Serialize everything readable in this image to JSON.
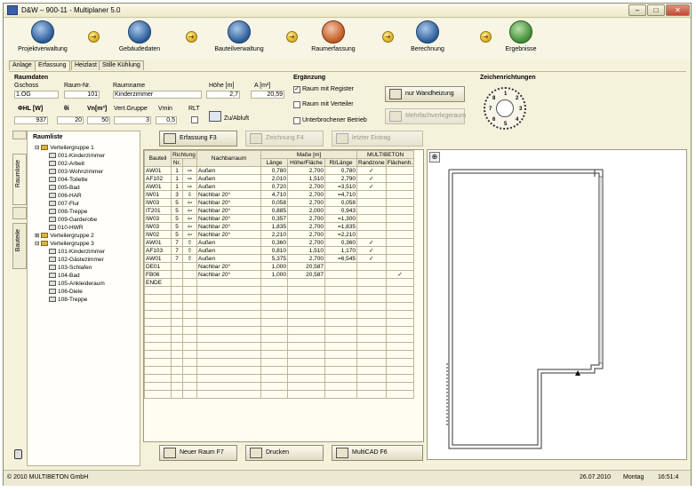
{
  "title": "D&W – 900-11 - Multiplaner 5.0",
  "window_controls": {
    "min": "–",
    "max": "□",
    "close": "✕"
  },
  "toolbar": [
    {
      "label": "Projektverwaltung",
      "icon": "project-icon"
    },
    {
      "label": "Gebäudedaten",
      "icon": "building-icon"
    },
    {
      "label": "Bauteilverwaltung",
      "icon": "component-icon"
    },
    {
      "label": "Raumerfassung",
      "icon": "room-entry-icon"
    },
    {
      "label": "Berechnung",
      "icon": "calculation-icon"
    },
    {
      "label": "Ergebnisse",
      "icon": "results-icon"
    }
  ],
  "tabs": [
    "Anlage",
    "Erfassung",
    "Heizlast",
    "Stille Kühlung"
  ],
  "raumdaten": {
    "heading": "Raumdaten",
    "geschoss_label": "Gschoss",
    "geschoss": "1.OG",
    "raumnr_label": "Raum-Nr.",
    "raumnr": "101",
    "raumname_label": "Raumname",
    "raumname": "Kinderzimmer",
    "hoehe_label": "Höhe [m]",
    "hoehe": "2,7",
    "flaeche_label": "A [m²]",
    "flaeche": "20,59",
    "phi_label": "ΦHL [W]",
    "phi": "937",
    "theta_label": "θi",
    "theta": "20",
    "vn_label": "Vn[m³]",
    "vn": "50",
    "vert_label": "Vert.Gruppe",
    "vert": "3",
    "vmin_label": "Vmin",
    "vmin": "0,5",
    "rlt_label": "RLT",
    "zu_abluft": "Zu/Abluft"
  },
  "ergaenzung": {
    "heading": "Ergänzung",
    "options": [
      {
        "label": "Raum mit Register",
        "checked": true
      },
      {
        "label": "Raum mit Verteiler",
        "checked": false
      },
      {
        "label": "Unterbrochener Betrieb",
        "checked": false
      }
    ]
  },
  "buttons": {
    "wandheizung": "nur Wandheizung",
    "mehrfach": "Mehrfachverlegeraum",
    "erfassung": "Erfassung F3",
    "zeichnung": "Zeichnung F4",
    "letzter": "letzter Eintrag",
    "neuer_raum": "Neuer Raum F7",
    "drucken": "Drucken",
    "multicad": "MultiCAD F6"
  },
  "zeichen": {
    "heading": "Zeichenrichtungen",
    "numbers": [
      "1",
      "2",
      "3",
      "4",
      "5",
      "6",
      "7",
      "8"
    ]
  },
  "sidebar_tabs": [
    "Raumliste",
    "Bauteile"
  ],
  "tree": {
    "heading": "Raumliste",
    "groups": [
      {
        "label": "Verteilergruppe 1",
        "rooms": [
          "001-Kinderzimmer",
          "002-Arbeit",
          "003-Wohnzimmer",
          "004-Toilette",
          "005-Bad",
          "006-HAR",
          "007-Flur",
          "008-Treppe",
          "009-Garderobe",
          "010-HWR"
        ]
      },
      {
        "label": "Verteilergruppe 2",
        "rooms": []
      },
      {
        "label": "Verteilergruppe 3",
        "rooms": [
          "101-Kinderzimmer",
          "102-Gästezimmer",
          "103-Schlafen",
          "104-Bad",
          "105-Ankleideraum",
          "106-Diele",
          "108-Treppe"
        ]
      }
    ]
  },
  "grid": {
    "headers": {
      "bauteil": "Bauteil",
      "richtung": "Richtung",
      "nr": "Nr.",
      "nachbarraum": "Nachbarraum",
      "masse": "Maße [m]",
      "laenge": "Länge",
      "hoehe": "Höhe/Fläche",
      "rl": "Rl/Länge",
      "multibeton": "MULTIBETON",
      "randzone": "Randzone",
      "flaechenh": "Flächenh."
    },
    "rows": [
      {
        "bt": "AW01",
        "nr": "1",
        "dir": "⇨",
        "nb": "Außen",
        "l": "0,780",
        "h": "2,700",
        "rl": "0,780",
        "rz": "✓",
        "fh": ""
      },
      {
        "bt": "AF102",
        "nr": "1",
        "dir": "⇨",
        "nb": "Außen",
        "l": "2,010",
        "h": "1,510",
        "rl": "2,790",
        "rz": "✓",
        "fh": ""
      },
      {
        "bt": "AW01",
        "nr": "1",
        "dir": "⇨",
        "nb": "Außen",
        "l": "0,720",
        "h": "2,700",
        "rl": "=3,510",
        "rz": "✓",
        "fh": ""
      },
      {
        "bt": "IW01",
        "nr": "3",
        "dir": "⇩",
        "nb": "Nachbar 20°",
        "l": "4,710",
        "h": "2,700",
        "rl": "=4,710",
        "rz": "",
        "fh": ""
      },
      {
        "bt": "IW03",
        "nr": "5",
        "dir": "⇦",
        "nb": "Nachbar 20°",
        "l": "0,058",
        "h": "2,700",
        "rl": "0,058",
        "rz": "",
        "fh": ""
      },
      {
        "bt": "IT201",
        "nr": "5",
        "dir": "⇦",
        "nb": "Nachbar 20°",
        "l": "0,885",
        "h": "2,000",
        "rl": "0,943",
        "rz": "",
        "fh": ""
      },
      {
        "bt": "IW03",
        "nr": "5",
        "dir": "⇦",
        "nb": "Nachbar 20°",
        "l": "0,357",
        "h": "2,700",
        "rl": "=1,300",
        "rz": "",
        "fh": ""
      },
      {
        "bt": "IW03",
        "nr": "5",
        "dir": "⇦",
        "nb": "Nachbar 20°",
        "l": "1,835",
        "h": "2,700",
        "rl": "=1,835",
        "rz": "",
        "fh": ""
      },
      {
        "bt": "IW02",
        "nr": "5",
        "dir": "⇦",
        "nb": "Nachbar 20°",
        "l": "2,210",
        "h": "2,700",
        "rl": "=2,210",
        "rz": "",
        "fh": ""
      },
      {
        "bt": "AW01",
        "nr": "7",
        "dir": "⇧",
        "nb": "Außen",
        "l": "0,360",
        "h": "2,700",
        "rl": "0,360",
        "rz": "✓",
        "fh": ""
      },
      {
        "bt": "AF103",
        "nr": "7",
        "dir": "⇧",
        "nb": "Außen",
        "l": "0,810",
        "h": "1,510",
        "rl": "1,170",
        "rz": "✓",
        "fh": ""
      },
      {
        "bt": "AW01",
        "nr": "7",
        "dir": "⇧",
        "nb": "Außen",
        "l": "5,375",
        "h": "2,700",
        "rl": "=6,545",
        "rz": "✓",
        "fh": ""
      },
      {
        "bt": "DE01",
        "nr": "",
        "dir": "",
        "nb": "Nachbar 20°",
        "l": "1,000",
        "h": "20,587",
        "rl": "",
        "rz": "",
        "fh": ""
      },
      {
        "bt": "FB06",
        "nr": "",
        "dir": "",
        "nb": "Nachbar 20°",
        "l": "1,000",
        "h": "20,587",
        "rl": "",
        "rz": "",
        "fh": "✓"
      },
      {
        "bt": "ENDE",
        "nr": "",
        "dir": "",
        "nb": "",
        "l": "",
        "h": "",
        "rl": "",
        "rz": "",
        "fh": ""
      }
    ]
  },
  "status": {
    "copyright": "© 2010 MULTIBETON GmbH",
    "date": "26.07.2010",
    "day": "Montag",
    "time": "16:51:4"
  },
  "colors": {
    "background": "#f5f2dc",
    "accent": "#2a5a96"
  }
}
